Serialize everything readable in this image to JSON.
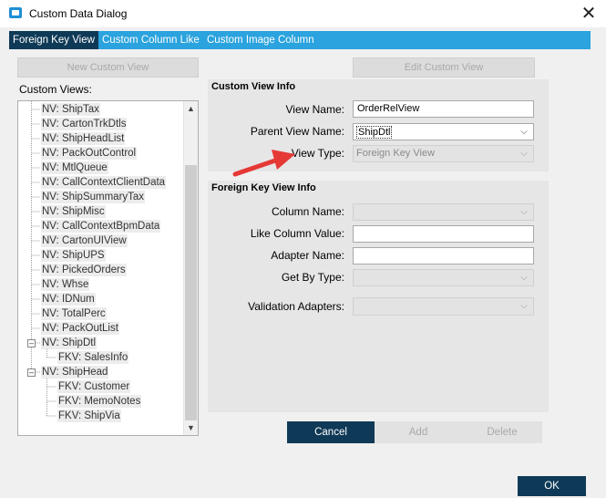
{
  "window": {
    "title": "Custom Data Dialog",
    "close_glyph": "✕"
  },
  "tabs": [
    {
      "label": "Foreign Key View",
      "active": true
    },
    {
      "label": "Custom Column Like",
      "active": false
    },
    {
      "label": "Custom Image Column",
      "active": false
    }
  ],
  "left": {
    "new_view_button": "New Custom View",
    "custom_views_label": "Custom Views:",
    "tree": [
      "NV: ShipTax",
      "NV: CartonTrkDtls",
      "NV: ShipHeadList",
      "NV: PackOutControl",
      "NV: MtlQueue",
      "NV: CallContextClientData",
      "NV: ShipSummaryTax",
      "NV: ShipMisc",
      "NV: CallContextBpmData",
      "NV: CartonUIView",
      "NV: ShipUPS",
      "NV: PickedOrders",
      "NV: Whse",
      "NV: IDNum",
      "NV: TotalPerc",
      "NV: PackOutList",
      "NV: ShipDtl",
      "FKV: SalesInfo",
      "NV: ShipHead",
      "FKV: Customer",
      "FKV: MemoNotes",
      "FKV: ShipVia"
    ]
  },
  "right": {
    "edit_view_button": "Edit Custom View",
    "custom_view_info": {
      "title": "Custom View Info",
      "view_name_label": "View Name:",
      "view_name_value": "OrderRelView",
      "parent_view_label": "Parent View Name:",
      "parent_view_value": "ShipDtl",
      "view_type_label": "View Type:",
      "view_type_value": "Foreign Key View"
    },
    "fk_view_info": {
      "title": "Foreign Key View Info",
      "column_name_label": "Column Name:",
      "like_column_label": "Like Column Value:",
      "adapter_name_label": "Adapter Name:",
      "get_by_type_label": "Get By Type:",
      "validation_adapters_label": "Validation Adapters:"
    }
  },
  "actions": {
    "cancel": "Cancel",
    "add": "Add",
    "delete": "Delete",
    "ok": "OK"
  },
  "colors": {
    "tab_strip": "#2aa3de",
    "tab_active": "#0f3a57",
    "primary_button": "#0f3a57",
    "arrow": "#e53935"
  },
  "icons": {
    "expand_minus": "minus-box-icon",
    "scroll_up": "chevron-up-icon",
    "scroll_down": "chevron-down-icon",
    "dropdown": "chevron-down-icon"
  }
}
